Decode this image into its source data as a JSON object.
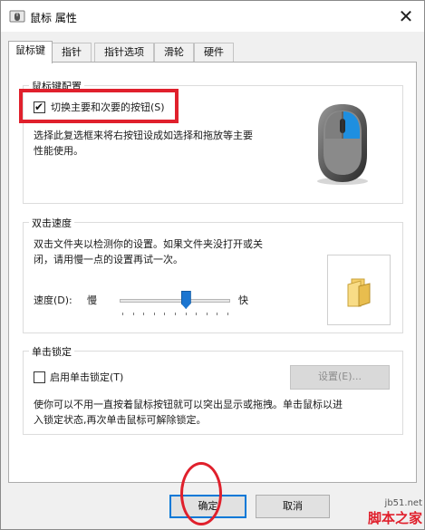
{
  "window": {
    "title": "鼠标 属性",
    "close_glyph": "✕"
  },
  "tabs": [
    {
      "label": "鼠标键",
      "active": true
    },
    {
      "label": "指针"
    },
    {
      "label": "指针选项"
    },
    {
      "label": "滑轮"
    },
    {
      "label": "硬件"
    }
  ],
  "button_config": {
    "group_label": "鼠标键配置",
    "switch_checkbox_label": "切换主要和次要的按钮(S)",
    "switch_checked": true,
    "description_line1": "选择此复选框来将右按钮设成如选择和拖放等主要",
    "description_line2": "性能使用。"
  },
  "double_click": {
    "group_label": "双击速度",
    "description_line1": "双击文件夹以检测你的设置。如果文件夹没打开或关",
    "description_line2": "闭，请用慢一点的设置再试一次。",
    "speed_label": "速度(D):",
    "slow_label": "慢",
    "fast_label": "快",
    "speed_level": 0.6
  },
  "click_lock": {
    "group_label": "单击锁定",
    "checkbox_label": "启用单击锁定(T)",
    "checked": false,
    "settings_button": "设置(E)...",
    "description_line1": "使你可以不用一直按着鼠标按钮就可以突出显示或拖拽。单击鼠标以进",
    "description_line2": "入锁定状态,再次单击鼠标可解除锁定。"
  },
  "footer": {
    "ok_button": "确定",
    "cancel_button": "取消"
  },
  "watermark": {
    "url": "jb51.net",
    "text": "脚本之家"
  },
  "colors": {
    "accent_blue": "#1b75d0",
    "annotation_red": "#e0202c"
  }
}
